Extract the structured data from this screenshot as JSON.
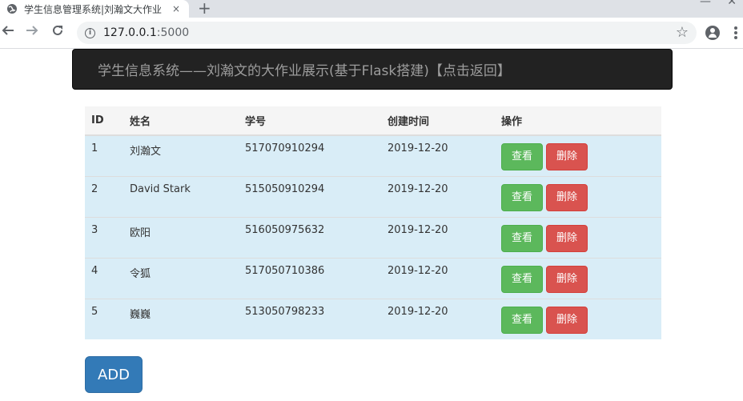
{
  "browser": {
    "tab_title": "学生信息管理系统|刘瀚文大作业",
    "tab_close": "×",
    "new_tab": "+",
    "url_host": "127.0.0.1",
    "url_port": ":5000"
  },
  "navbar": {
    "brand": "学生信息系统——刘瀚文的大作业展示(基于Flask搭建)【点击返回】"
  },
  "table": {
    "headers": [
      "ID",
      "姓名",
      "学号",
      "创建时间",
      "操作"
    ],
    "rows": [
      {
        "id": "1",
        "name": "刘瀚文",
        "student_no": "517070910294",
        "created": "2019-12-20"
      },
      {
        "id": "2",
        "name": "David Stark",
        "student_no": "515050910294",
        "created": "2019-12-20"
      },
      {
        "id": "3",
        "name": "欧阳",
        "student_no": "516050975632",
        "created": "2019-12-20"
      },
      {
        "id": "4",
        "name": "令狐",
        "student_no": "517050710386",
        "created": "2019-12-20"
      },
      {
        "id": "5",
        "name": "巍巍",
        "student_no": "513050798233",
        "created": "2019-12-20"
      }
    ],
    "view_label": "查看",
    "delete_label": "删除"
  },
  "add_label": "ADD",
  "colors": {
    "navbar_bg": "#222222",
    "row_bg": "#d9edf7",
    "success": "#5cb85c",
    "danger": "#d9534f",
    "primary": "#337ab7"
  }
}
